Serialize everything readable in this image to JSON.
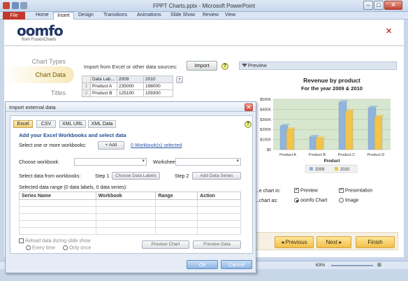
{
  "window": {
    "title": "FPPT Charts.pptx - Microsoft PowerPoint"
  },
  "ribbon": {
    "file": "File",
    "tabs": [
      "Home",
      "Insert",
      "Design",
      "Transitions",
      "Animations",
      "Slide Show",
      "Review",
      "View"
    ],
    "active": "Insert"
  },
  "brand": {
    "logo": "oomfo",
    "sub": "from FusionCharts"
  },
  "nav": {
    "items": [
      "Chart Types",
      "Chart Data",
      "Titles"
    ],
    "active": "Chart Data"
  },
  "data_source": {
    "label": "Import from Excel or other data sources:",
    "import_button": "Import",
    "grid": {
      "headers": [
        "Data Lab...",
        "2009",
        "2010"
      ],
      "rows": [
        [
          "Product A",
          "235000",
          "198000"
        ],
        [
          "Product B",
          "125100",
          "109300"
        ]
      ],
      "add": "+"
    }
  },
  "preview": {
    "header": "Preview",
    "legend_items": [
      "2009",
      "2010"
    ],
    "options": {
      "show_label": "...e chart in:",
      "preview": "Preview",
      "presentation": "Presentation",
      "as_label": "...chart as:",
      "oomfo_chart": "oomfo Chart",
      "image": "Image"
    }
  },
  "chart_data": {
    "type": "bar",
    "title": "Revenue by product",
    "subtitle": "For the year 2009 & 2010",
    "xlabel": "Product",
    "ylabel": "",
    "categories": [
      "Product A",
      "Product B",
      "Product C",
      "Product D"
    ],
    "series": [
      {
        "name": "2009",
        "values": [
          235000,
          125100,
          470000,
          415000
        ]
      },
      {
        "name": "2010",
        "values": [
          198000,
          109300,
          378000,
          322000
        ]
      }
    ],
    "ylim": [
      0,
      500000
    ],
    "yticks": [
      "$0",
      "$100K",
      "$200K",
      "$300K",
      "$400K",
      "$500K"
    ],
    "colors": {
      "2009": "#8fb4de",
      "2010": "#f2c44a"
    },
    "legend": "bottom"
  },
  "wizard_nav": {
    "previous": "Previous",
    "next": "Next",
    "finish": "Finish"
  },
  "dialog": {
    "title": "Import external data",
    "tabs": [
      "Excel",
      "CSV",
      "XML URL",
      "XML Data"
    ],
    "heading": "Add your Excel Workbooks and select data",
    "select_label": "Select one or more workbooks:",
    "add_button": "Add",
    "selected": "0 Workbook(s) selected",
    "choose_workbook": "Choose workbook:",
    "worksheet": "Worksheet:",
    "select_data": "Select data from workbooks:",
    "step1": "Step 1",
    "choose_labels": "Choose Data Labels",
    "step2": "Step 2",
    "add_series": "Add Data Series",
    "range_label": "Selected data range (0 data labels, 0 data series):",
    "columns": [
      "Series Name",
      "Workbook",
      "Range",
      "Action"
    ],
    "reload": "Reload data during slide show",
    "every_time": "Every time",
    "only_once": "Only once",
    "preview_chart": "Preview Chart",
    "preview_data": "Preview Data",
    "ok": "Ok",
    "cancel": "Cancel"
  },
  "status": {
    "zoom": "63%"
  }
}
